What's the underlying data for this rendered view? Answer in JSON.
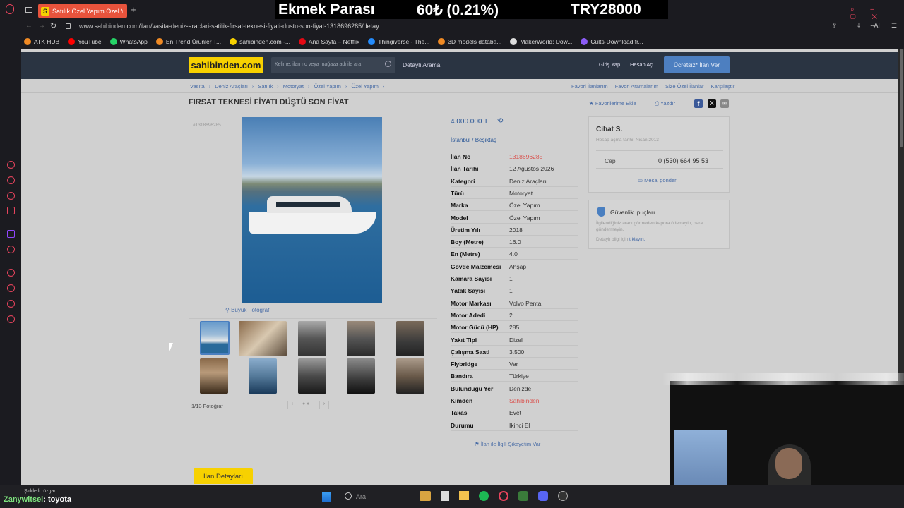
{
  "browser": {
    "tab_title": "Satılık Özel Yapım Özel Yap",
    "tab_favicon": "S",
    "url": "www.sahibinden.com/ilan/vasita-deniz-araclari-satilik-firsat-teknesi-fiyati-dustu-son-fiyat-1318696285/detay",
    "bookmarks": [
      {
        "label": "ATK HUB",
        "color": "#f08a24"
      },
      {
        "label": "YouTube",
        "color": "#ff0000"
      },
      {
        "label": "WhatsApp",
        "color": "#25d366"
      },
      {
        "label": "En Trend Ürünler T...",
        "color": "#f08a24"
      },
      {
        "label": "sahibinden.com -...",
        "color": "#f7d100"
      },
      {
        "label": "Ana Sayfa – Netflix",
        "color": "#e50914"
      },
      {
        "label": "Thingiverse - The...",
        "color": "#248bfb"
      },
      {
        "label": "3D models databa...",
        "color": "#f08a24"
      },
      {
        "label": "MakerWorld: Dow...",
        "color": "#dddddd"
      },
      {
        "label": "Cults-Download fr...",
        "color": "#8b5cf6"
      }
    ]
  },
  "ticker": {
    "name": "Ekmek Parası",
    "price": "60₺ (0.21%)",
    "total": "TRY28000"
  },
  "site": {
    "logo": "sahibinden.com",
    "search_placeholder": "Kelime, ilan no veya mağaza adı ile ara",
    "advanced_search": "Detaylı Arama",
    "login": "Giriş Yap",
    "register": "Hesap Aç",
    "post_ad": "Ücretsiz* İlan Ver",
    "breadcrumbs": [
      "Vasıta",
      "Deniz Araçları",
      "Satılık",
      "Motoryat",
      "Özel Yapım",
      "Özel Yapım"
    ],
    "top_links": [
      "Favori İlanlarım",
      "Favori Aramalarım",
      "Size Özel İlanlar",
      "Karşılaştır"
    ]
  },
  "listing": {
    "title": "FIRSAT TEKNESİ FİYATI DÜŞTÜ SON FİYAT",
    "id_small": "#1318696285",
    "fav_label": "Favorilerime Ekle",
    "print_label": "Yazdır",
    "price": "4.000.000 TL",
    "location_city": "İstanbul",
    "location_district": "Beşiktaş",
    "big_photo": "Büyük Fotoğraf",
    "photo_count": "1/13 Fotoğraf",
    "details_tab": "İlan Detayları",
    "complaint": "İlan ile İlgili Şikayetim Var",
    "specs": [
      {
        "label": "İlan No",
        "value": "1318696285",
        "red": true
      },
      {
        "label": "İlan Tarihi",
        "value": "12 Ağustos 2026"
      },
      {
        "label": "Kategori",
        "value": "Deniz Araçları"
      },
      {
        "label": "Türü",
        "value": "Motoryat"
      },
      {
        "label": "Marka",
        "value": "Özel Yapım"
      },
      {
        "label": "Model",
        "value": "Özel Yapım"
      },
      {
        "label": "Üretim Yılı",
        "value": "2018"
      },
      {
        "label": "Boy (Metre)",
        "value": "16.0"
      },
      {
        "label": "En (Metre)",
        "value": "4.0"
      },
      {
        "label": "Gövde Malzemesi",
        "value": "Ahşap"
      },
      {
        "label": "Kamara Sayısı",
        "value": "1"
      },
      {
        "label": "Yatak Sayısı",
        "value": "1"
      },
      {
        "label": "Motor Markası",
        "value": "Volvo Penta"
      },
      {
        "label": "Motor Adedi",
        "value": "2"
      },
      {
        "label": "Motor Gücü (HP)",
        "value": "285"
      },
      {
        "label": "Yakıt Tipi",
        "value": "Dizel"
      },
      {
        "label": "Çalışma Saati",
        "value": "3.500"
      },
      {
        "label": "Flybridge",
        "value": "Var"
      },
      {
        "label": "Bandıra",
        "value": "Türkiye"
      },
      {
        "label": "Bulunduğu Yer",
        "value": "Denizde"
      },
      {
        "label": "Kimden",
        "value": "Sahibinden",
        "red": true
      },
      {
        "label": "Takas",
        "value": "Evet"
      },
      {
        "label": "Durumu",
        "value": "İkinci El"
      }
    ]
  },
  "seller": {
    "name": "Cihat S.",
    "since": "Hesap açma tarihi: Nisan 2013",
    "phone_label": "Cep",
    "phone": "0 (530) 664 95 53",
    "message": "Mesaj gönder"
  },
  "safety": {
    "title": "Güvenlik İpuçları",
    "text": "İlgilendiğiniz aracı görmeden kapora ödemeyin, para göndermeyin.",
    "more_prefix": "Detaylı bilgi için",
    "more_link": "tıklayın."
  },
  "chat": {
    "user": "Zanywitsel",
    "message": ": toyota",
    "event": "Şiddetli rüzgar"
  },
  "taskbar": {
    "search": "Ara"
  }
}
